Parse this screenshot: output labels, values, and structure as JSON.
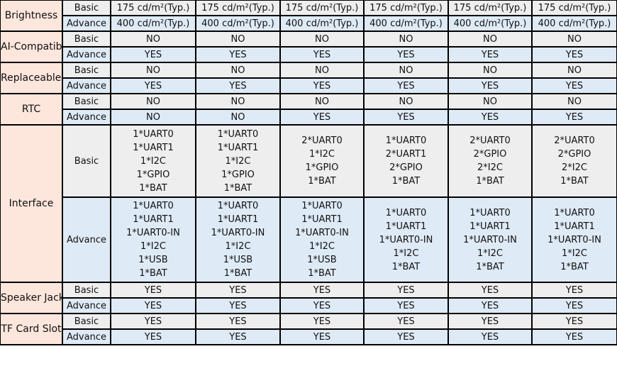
{
  "columns_count": 6,
  "rows": [
    {
      "feature": "Brightness",
      "basic": [
        "175 cd/m²(Typ.)",
        "175 cd/m²(Typ.)",
        "175 cd/m²(Typ.)",
        "175 cd/m²(Typ.)",
        "175 cd/m²(Typ.)",
        "175 cd/m²(Typ.)"
      ],
      "advance": [
        "400 cd/m²(Typ.)",
        "400 cd/m²(Typ.)",
        "400 cd/m²(Typ.)",
        "400 cd/m²(Typ.)",
        "400 cd/m²(Typ.)",
        "400 cd/m²(Typ.)"
      ]
    },
    {
      "feature": "AI-Compatible",
      "basic": [
        "NO",
        "NO",
        "NO",
        "NO",
        "NO",
        "NO"
      ],
      "advance": [
        "YES",
        "YES",
        "YES",
        "YES",
        "YES",
        "YES"
      ]
    },
    {
      "feature": "Replaceable Module",
      "basic": [
        "NO",
        "NO",
        "NO",
        "NO",
        "NO",
        "NO"
      ],
      "advance": [
        "YES",
        "YES",
        "YES",
        "YES",
        "YES",
        "YES"
      ]
    },
    {
      "feature": "RTC",
      "basic": [
        "NO",
        "NO",
        "NO",
        "NO",
        "NO",
        "NO"
      ],
      "advance": [
        "NO",
        "NO",
        "YES",
        "YES",
        "YES",
        "YES"
      ]
    },
    {
      "feature": "Interface",
      "basic": [
        [
          "1*UART0",
          "1*UART1",
          "1*I2C",
          "1*GPIO",
          "1*BAT"
        ],
        [
          "1*UART0",
          "1*UART1",
          "1*I2C",
          "1*GPIO",
          "1*BAT"
        ],
        [
          "2*UART0",
          "1*I2C",
          "1*GPIO",
          "1*BAT"
        ],
        [
          "1*UART0",
          "2*UART1",
          "2*GPIO",
          "1*BAT"
        ],
        [
          "2*UART0",
          "2*GPIO",
          "2*I2C",
          "1*BAT"
        ],
        [
          "2*UART0",
          "2*GPIO",
          "2*I2C",
          "1*BAT"
        ]
      ],
      "advance": [
        [
          "1*UART0",
          "1*UART1",
          "1*UART0-IN",
          "1*I2C",
          "1*USB",
          "1*BAT"
        ],
        [
          "1*UART0",
          "1*UART1",
          "1*UART0-IN",
          "1*I2C",
          "1*USB",
          "1*BAT"
        ],
        [
          "1*UART0",
          "1*UART1",
          "1*UART0-IN",
          "1*I2C",
          "1*USB",
          "1*BAT"
        ],
        [
          "1*UART0",
          "1*UART1",
          "1*UART0-IN",
          "1*I2C",
          "1*BAT"
        ],
        [
          "1*UART0",
          "1*UART1",
          "1*UART0-IN",
          "1*I2C",
          "1*BAT"
        ],
        [
          "1*UART0",
          "1*UART1",
          "1*UART0-IN",
          "1*I2C",
          "1*BAT"
        ]
      ]
    },
    {
      "feature": "Speaker Jack",
      "basic": [
        "YES",
        "YES",
        "YES",
        "YES",
        "YES",
        "YES"
      ],
      "advance": [
        "YES",
        "YES",
        "YES",
        "YES",
        "YES",
        "YES"
      ]
    },
    {
      "feature": "TF Card Slot",
      "basic": [
        "YES",
        "YES",
        "YES",
        "YES",
        "YES",
        "YES"
      ],
      "advance": [
        "YES",
        "YES",
        "YES",
        "YES",
        "YES",
        "YES"
      ]
    }
  ],
  "labels": {
    "basic": "Basic",
    "advance": "Advance"
  },
  "colors": {
    "feature_bg": "#fde6dc",
    "basic_bg": "#eeeeee",
    "advance_bg": "#deeaf6",
    "border": "#000000"
  }
}
